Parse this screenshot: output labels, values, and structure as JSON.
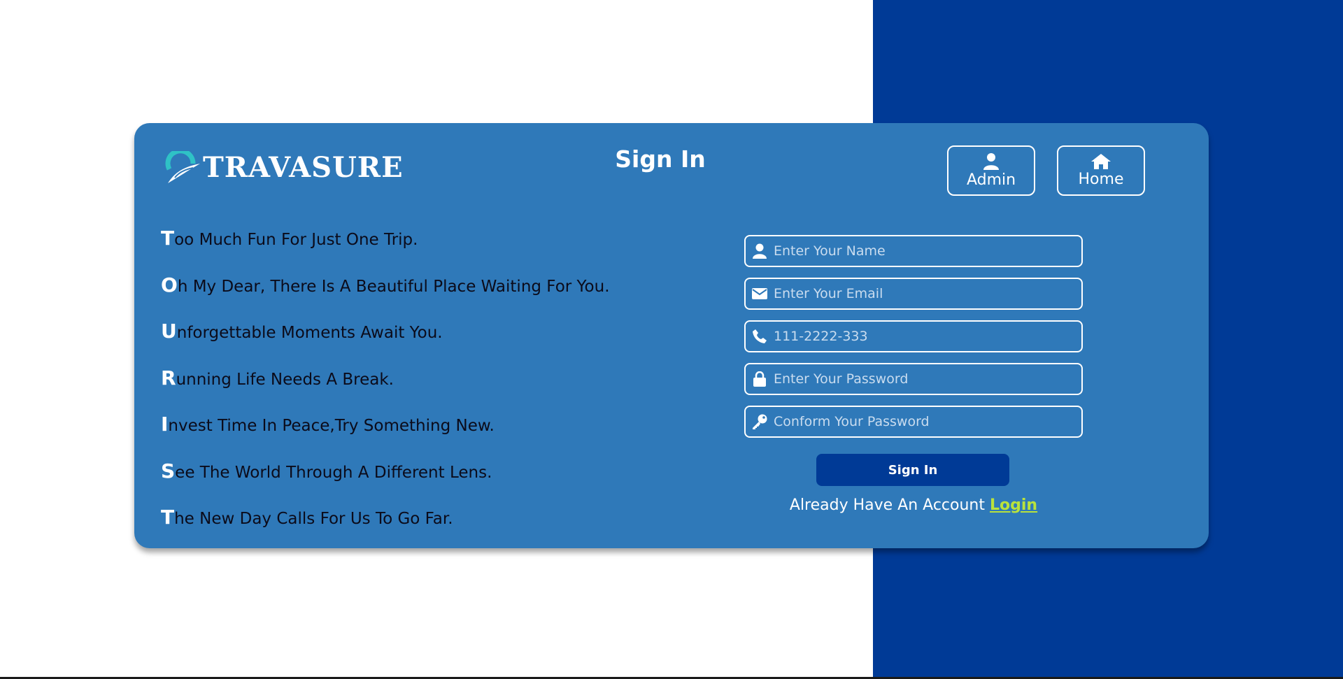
{
  "brand": {
    "logo_text": "TRAVASURE",
    "accent": "#2fc2c6"
  },
  "page": {
    "title": "Sign In"
  },
  "header_buttons": {
    "admin_label": "Admin",
    "home_label": "Home"
  },
  "slogans": [
    {
      "first": "T",
      "rest": "oo Much Fun For Just One Trip."
    },
    {
      "first": "O",
      "rest": "h My Dear, There Is A Beautiful Place Waiting For You."
    },
    {
      "first": "U",
      "rest": "nforgettable Moments Await You."
    },
    {
      "first": "R",
      "rest": "unning Life Needs A Break."
    },
    {
      "first": "I",
      "rest": "nvest Time In Peace,Try Something New."
    },
    {
      "first": "S",
      "rest": "ee The World Through A Different Lens."
    },
    {
      "first": "T",
      "rest": "he New Day Calls For Us To Go Far."
    }
  ],
  "form": {
    "name": {
      "placeholder": "Enter Your Name",
      "icon": "user-icon"
    },
    "email": {
      "placeholder": "Enter Your Email",
      "icon": "envelope-icon"
    },
    "phone": {
      "placeholder": "111-2222-333",
      "icon": "phone-icon"
    },
    "password": {
      "placeholder": "Enter Your Password",
      "icon": "lock-icon"
    },
    "confirm": {
      "placeholder": "Conform Your Password",
      "icon": "key-icon"
    },
    "submit_label": "Sign In",
    "already_text": "Already Have An Account",
    "login_link": "Login"
  },
  "colors": {
    "card": "#2f79b9",
    "dark_blue": "#003a96",
    "link": "#b9e23c"
  }
}
